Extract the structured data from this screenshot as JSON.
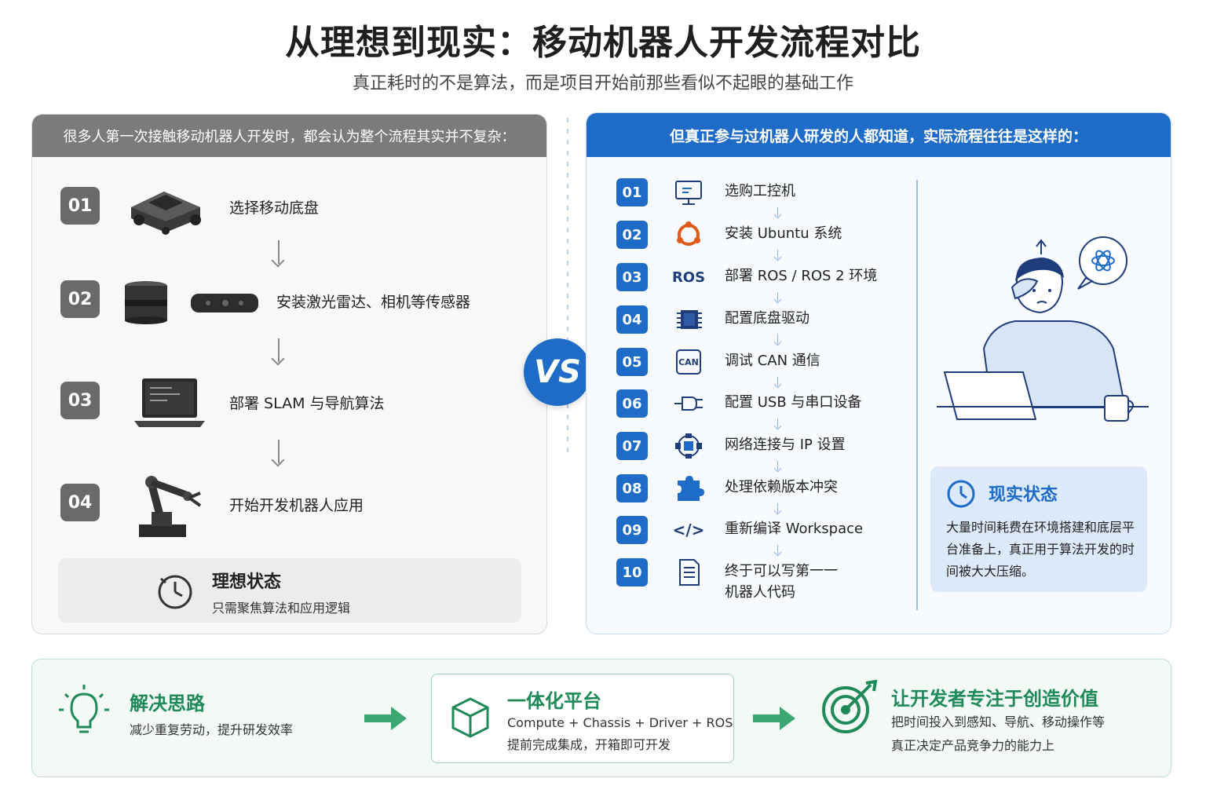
{
  "title": "从理想到现实：移动机器人开发流程对比",
  "subtitle": "真正耗时的不是算法，而是项目开始前那些看似不起眼的基础工作",
  "left_panel": {
    "header": "很多人第一次接触移动机器人开发时，都会认为整个流程其实并不复杂：",
    "steps": [
      {
        "num": "01",
        "label": "选择移动底盘"
      },
      {
        "num": "02",
        "label": "安装激光雷达、相机等传感器"
      },
      {
        "num": "03",
        "label": "部署 SLAM 与导航算法"
      },
      {
        "num": "04",
        "label": "开始开发机器人应用"
      }
    ],
    "ideal": {
      "title": "理想状态",
      "desc": "只需聚焦算法和应用逻辑"
    }
  },
  "vs": "VS",
  "right_panel": {
    "header": "但真正参与过机器人研发的人都知道，实际流程往往是这样的：",
    "steps": [
      {
        "num": "01",
        "label": "选购工控机",
        "icon": "monitor-icon"
      },
      {
        "num": "02",
        "label": "安装 Ubuntu 系统",
        "icon": "ubuntu-icon"
      },
      {
        "num": "03",
        "label": "部署 ROS / ROS 2 环境",
        "icon": "ros-icon",
        "icon_text": "ROS"
      },
      {
        "num": "04",
        "label": "配置底盘驱动",
        "icon": "chip-icon"
      },
      {
        "num": "05",
        "label": "调试 CAN 通信",
        "icon": "can-icon",
        "icon_text": "CAN"
      },
      {
        "num": "06",
        "label": "配置 USB 与串口设备",
        "icon": "usb-plug-icon"
      },
      {
        "num": "07",
        "label": "网络连接与 IP 设置",
        "icon": "network-icon"
      },
      {
        "num": "08",
        "label": "处理依赖版本冲突",
        "icon": "puzzle-icon"
      },
      {
        "num": "09",
        "label": "重新编译 Workspace",
        "icon": "code-icon",
        "icon_text": "</>"
      },
      {
        "num": "10",
        "label_line1": "终于可以写第一一",
        "label_line2": "机器人代码",
        "icon": "document-icon"
      }
    ],
    "reality": {
      "title": "现实状态",
      "desc": "大量时间耗费在环境搭建和底层平台准备上，真正用于算法开发的时间被大大压缩。"
    }
  },
  "bottom": {
    "solution": {
      "title": "解决思路",
      "desc": "减少重复劳动，提升研发效率"
    },
    "platform": {
      "title": "一体化平台",
      "line1": "Compute + Chassis + Driver + ROS",
      "line2": "提前完成集成，开箱即可开发"
    },
    "value": {
      "title": "让开发者专注于创造价值",
      "line1": "把时间投入到感知、导航、移动操作等",
      "line2": "真正决定产品竞争力的能力上"
    }
  },
  "colors": {
    "blue": "#1e6cc7",
    "gray": "#6a6a6a",
    "green": "#1f8a57"
  }
}
